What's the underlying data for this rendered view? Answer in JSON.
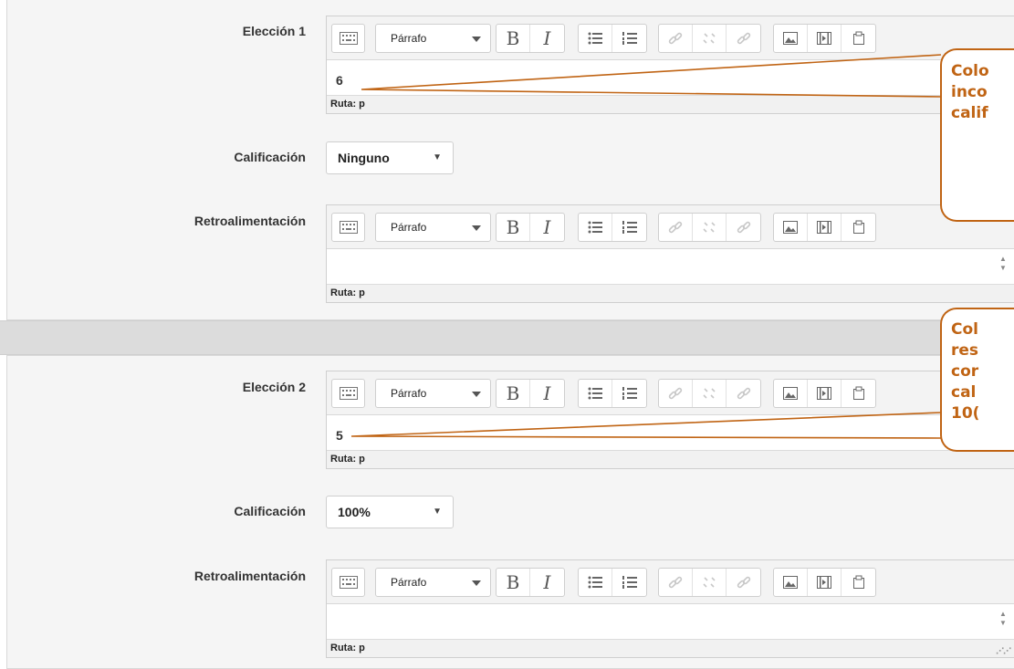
{
  "toolbar": {
    "format_value": "Párrafo",
    "bold_label": "B",
    "italic_label": "I",
    "icons": [
      "toolbar-toggle-icon",
      "bulleted-list-icon",
      "numbered-list-icon",
      "link-icon",
      "unlink-icon",
      "anchor-icon",
      "image-icon",
      "media-icon",
      "paste-icon"
    ]
  },
  "choices": [
    {
      "label": "Elección 1",
      "answer": "6",
      "path": "Ruta: p",
      "grade_label": "Calificación",
      "grade_value": "Ninguno",
      "feedback_label": "Retroalimentación",
      "feedback_path": "Ruta: p"
    },
    {
      "label": "Elección 2",
      "answer": "5",
      "path": "Ruta: p",
      "grade_label": "Calificación",
      "grade_value": "100%",
      "feedback_label": "Retroalimentación",
      "feedback_path": "Ruta: p"
    }
  ],
  "callouts": [
    {
      "text": "Colo\ninco\ncalif"
    },
    {
      "text": "Col\nres\ncor\ncal\n10("
    }
  ],
  "colors": {
    "callout": "#c06414",
    "panel": "#f5f5f5",
    "band": "#dcdcdc"
  }
}
